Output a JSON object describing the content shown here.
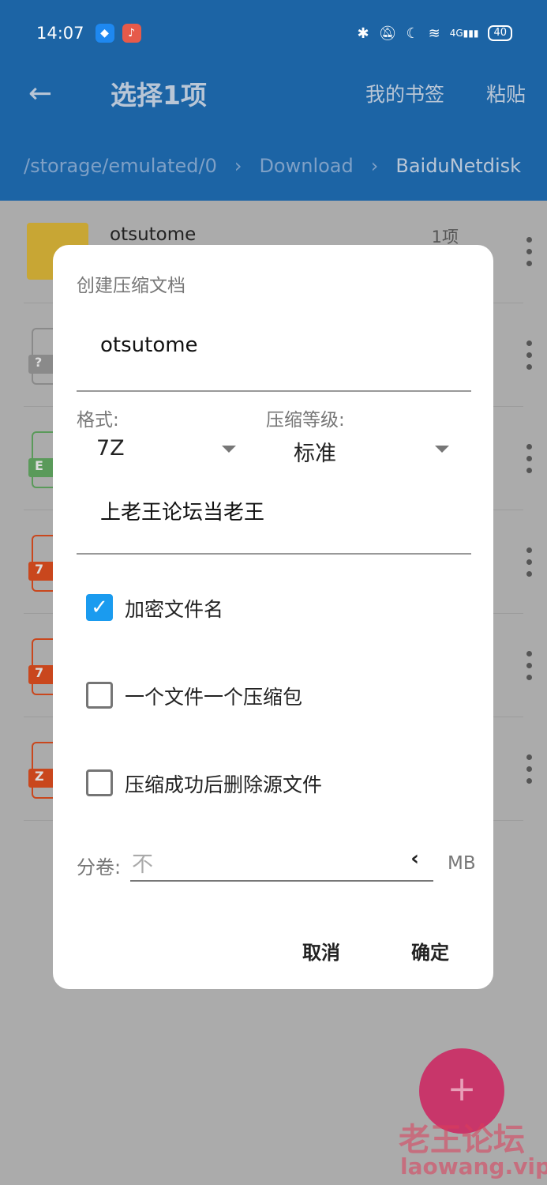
{
  "status": {
    "time": "14:07",
    "battery": "40",
    "network": "4G"
  },
  "toolbar": {
    "title": "选择1项",
    "bookmarks": "我的书签",
    "paste": "粘贴"
  },
  "breadcrumb": [
    "/storage/emulated/0",
    "Download",
    "BaiduNetdisk"
  ],
  "list": [
    {
      "name": "otsutome",
      "meta": "1项",
      "type": "folder"
    },
    {
      "tag": "?",
      "color": "#8a8a8a"
    },
    {
      "tag": "E",
      "color": "#5a9a5a"
    },
    {
      "tag": "7",
      "color": "#c9471d"
    },
    {
      "tag": "7",
      "color": "#c9471d"
    },
    {
      "tag": "Z",
      "color": "#c9471d"
    }
  ],
  "dialog": {
    "title": "创建压缩文档",
    "filename": "otsutome",
    "format_label": "格式:",
    "format_value": "7Z",
    "level_label": "压缩等级:",
    "level_value": "标准",
    "password": "上老王论坛当老王",
    "options": [
      {
        "label": "加密文件名",
        "checked": true
      },
      {
        "label": "一个文件一个压缩包",
        "checked": false
      },
      {
        "label": "压缩成功后删除源文件",
        "checked": false
      }
    ],
    "split_label": "分卷:",
    "split_placeholder": "不",
    "split_unit": "MB",
    "cancel": "取消",
    "ok": "确定"
  },
  "fab": "+",
  "watermark": {
    "text": "老王论坛",
    "url": "laowang.vip"
  },
  "colors": {
    "header": "#1c64a5",
    "accent": "#1a9bef",
    "fab": "#c8366a"
  }
}
